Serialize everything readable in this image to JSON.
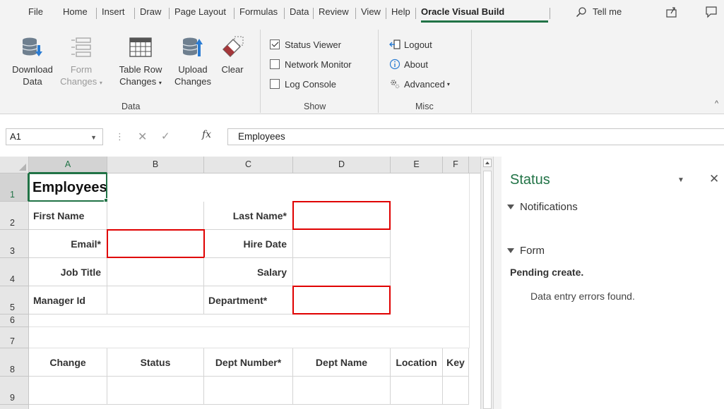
{
  "tabs": [
    {
      "label": "File"
    },
    {
      "label": "Home"
    },
    {
      "label": "Insert"
    },
    {
      "label": "Draw"
    },
    {
      "label": "Page Layout"
    },
    {
      "label": "Formulas"
    },
    {
      "label": "Data"
    },
    {
      "label": "Review"
    },
    {
      "label": "View"
    },
    {
      "label": "Help"
    },
    {
      "label": "Oracle Visual Build"
    }
  ],
  "active_tab": "Oracle Visual Build",
  "tell_me": "Tell me",
  "ribbon": {
    "data_group": {
      "label": "Data",
      "buttons": [
        {
          "line1": "Download",
          "line2": "Data",
          "icon": "download-data-icon",
          "enabled": true
        },
        {
          "line1": "Form",
          "line2": "Changes",
          "icon": "form-changes-icon",
          "enabled": false,
          "dropdown": true
        },
        {
          "line1": "Table Row",
          "line2": "Changes",
          "icon": "table-row-changes-icon",
          "enabled": true,
          "dropdown": true
        },
        {
          "line1": "Upload",
          "line2": "Changes",
          "icon": "upload-changes-icon",
          "enabled": true
        },
        {
          "line1": "Clear",
          "line2": "",
          "icon": "clear-icon",
          "enabled": true
        }
      ]
    },
    "show_group": {
      "label": "Show",
      "items": [
        {
          "label": "Status Viewer",
          "checked": true
        },
        {
          "label": "Network Monitor",
          "checked": false
        },
        {
          "label": "Log Console",
          "checked": false
        }
      ]
    },
    "misc_group": {
      "label": "Misc",
      "items": [
        {
          "label": "Logout",
          "icon": "logout-icon"
        },
        {
          "label": "About",
          "icon": "info-icon"
        },
        {
          "label": "Advanced",
          "icon": "gear-icon",
          "dropdown": true
        }
      ]
    }
  },
  "formula_bar": {
    "name_box": "A1",
    "fx": "fx",
    "value": "Employees"
  },
  "sheet": {
    "columns": [
      "A",
      "B",
      "C",
      "D",
      "E",
      "F"
    ],
    "rows": [
      "1",
      "2",
      "3",
      "4",
      "5",
      "6",
      "7",
      "8",
      "9"
    ],
    "title": "Employees",
    "form": {
      "first_name_label": "First Name",
      "last_name_label": "Last Name*",
      "email_label": "Email*",
      "hire_date_label": "Hire Date",
      "job_title_label": "Job Title",
      "salary_label": "Salary",
      "manager_id_label": "Manager Id",
      "department_label": "Department*"
    },
    "table_headers": [
      "Change",
      "Status",
      "Dept Number*",
      "Dept Name",
      "Location",
      "Key"
    ]
  },
  "status_pane": {
    "title": "Status",
    "notifications": "Notifications",
    "form": "Form",
    "pending": "Pending create.",
    "message": "Data entry errors found."
  },
  "colors": {
    "accent": "#217346",
    "error_border": "#e00000"
  }
}
